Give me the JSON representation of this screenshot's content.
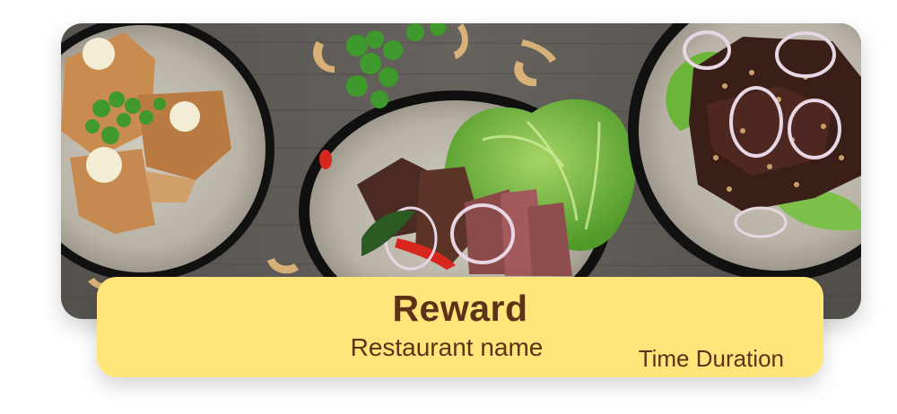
{
  "card": {
    "title": "Reward",
    "restaurant_name": "Restaurant name",
    "time_duration": "Time Duration"
  },
  "colors": {
    "card_background": "#FFE57A",
    "text": "#5A3417",
    "table_wood": "#5C5853"
  }
}
